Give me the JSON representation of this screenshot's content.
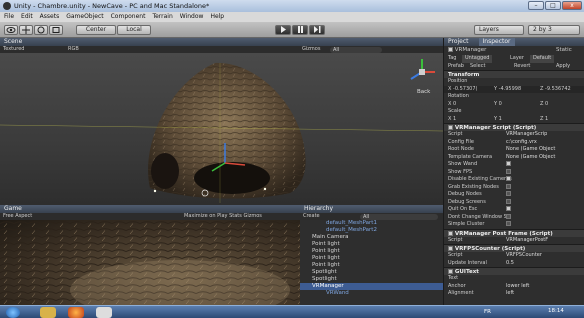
{
  "window": {
    "title": "Unity - Chambre.unity - NewCave - PC and Mac Standalone*",
    "min": "–",
    "max": "□",
    "close": "x"
  },
  "menu": [
    "File",
    "Edit",
    "Assets",
    "GameObject",
    "Component",
    "Terrain",
    "Window",
    "Help"
  ],
  "toolbar": {
    "pivot_label": "Center",
    "space_label": "Local",
    "layers_label": "Layers",
    "layout_label": "2 by 3"
  },
  "scene": {
    "tab": "Scene",
    "render_mode": "Textured",
    "color_mode": "RGB",
    "gizmos": "Gizmos",
    "search": "All",
    "axis_label": "Back"
  },
  "game": {
    "tab": "Game",
    "aspect": "Free Aspect",
    "options": "Maximize on Play  Stats  Gizmos"
  },
  "hierarchy": {
    "tab": "Hierarchy",
    "create": "Create",
    "search": "All",
    "items": [
      {
        "label": "default_MeshPart1",
        "kind": "child"
      },
      {
        "label": "default_MeshPart2",
        "kind": "child"
      },
      {
        "label": "Main Camera",
        "kind": "normal"
      },
      {
        "label": "Point light",
        "kind": "normal"
      },
      {
        "label": "Point light",
        "kind": "normal"
      },
      {
        "label": "Point light",
        "kind": "normal"
      },
      {
        "label": "Point light",
        "kind": "normal"
      },
      {
        "label": "Spotlight",
        "kind": "normal"
      },
      {
        "label": "Spotlight",
        "kind": "normal"
      },
      {
        "label": "VRManager",
        "kind": "selected"
      },
      {
        "label": "VRWand",
        "kind": "child"
      }
    ]
  },
  "inspector": {
    "project_tab": "Project",
    "inspector_tab": "Inspector",
    "object_name": "VRManager",
    "static_label": "Static",
    "tag_label": "Tag",
    "tag_value": "Untagged",
    "layer_label": "Layer",
    "layer_value": "Default",
    "prefab_label": "Prefab",
    "prefab_select": "Select",
    "prefab_revert": "Revert",
    "prefab_apply": "Apply",
    "transform": {
      "title": "Transform",
      "position_label": "Position",
      "pos_x": "X -0.57307(",
      "pos_y": "Y -4.95998",
      "pos_z": "Z -9.536742",
      "rotation_label": "Rotation",
      "rot_x": "X 0",
      "rot_y": "Y 0",
      "rot_z": "Z 0",
      "scale_label": "Scale",
      "scl_x": "X 1",
      "scl_y": "Y 1",
      "scl_z": "Z 1"
    },
    "vrmanager_script": {
      "title": "VRManager Script (Script)",
      "rows": [
        {
          "label": "Script",
          "value": "VRManagerScrip"
        },
        {
          "label": "Config File",
          "value": "c:\\config.vrx"
        },
        {
          "label": "Root Node",
          "value": "None (Game Object"
        },
        {
          "label": "Template Camera",
          "value": "None (Game Object"
        },
        {
          "label": "Show Wand",
          "value": "",
          "check": true
        },
        {
          "label": "Show FPS",
          "value": "",
          "check": false
        },
        {
          "label": "Disable Existing Cameras",
          "value": "",
          "check": true
        },
        {
          "label": "Grab Existing Nodes",
          "value": "",
          "check": false
        },
        {
          "label": "Debug Nodes",
          "value": "",
          "check": false
        },
        {
          "label": "Debug Screens",
          "value": "",
          "check": false
        },
        {
          "label": "Quit On Esc",
          "value": "",
          "check": true
        },
        {
          "label": "Dont Change Window Siz",
          "value": "",
          "check": false
        },
        {
          "label": "Simple Cluster",
          "value": "",
          "check": false
        }
      ]
    },
    "postframe": {
      "title": "VRManager Post Frame (Script)",
      "script_label": "Script",
      "script_value": "VRManagerPostF"
    },
    "fpscounter": {
      "title": "VRFPSCounter (Script)",
      "script_label": "Script",
      "script_value": "VRFPSCounter",
      "interval_label": "Update Interval",
      "interval_value": "0.5"
    },
    "guitext": {
      "title": "GUIText",
      "text_label": "Text",
      "anchor_label": "Anchor",
      "anchor_value": "lower left",
      "alignment_label": "Alignment",
      "alignment_value": "left"
    }
  },
  "taskbar": {
    "lang": "FR",
    "time": "18:14"
  }
}
